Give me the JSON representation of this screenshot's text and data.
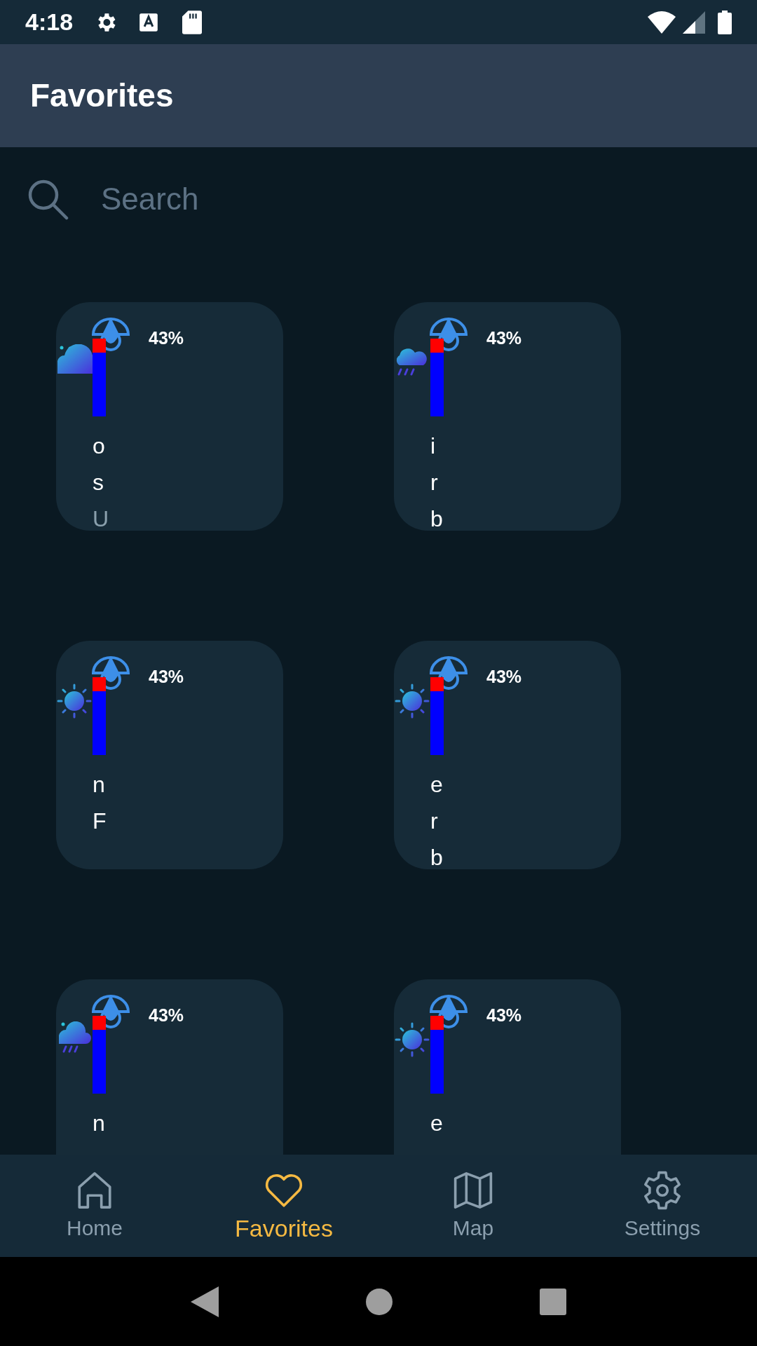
{
  "status_bar": {
    "time": "4:18"
  },
  "app_bar": {
    "title": "Favorites"
  },
  "search": {
    "placeholder": "Search"
  },
  "cards": [
    {
      "kind": "partly_cloudy",
      "humidity": "43%",
      "lines": [
        {
          "text": "o",
          "muted": false
        },
        {
          "text": "s",
          "muted": false
        },
        {
          "text": "U",
          "muted": true
        }
      ]
    },
    {
      "kind": "rain",
      "humidity": "43%",
      "lines": [
        {
          "text": "i",
          "muted": false
        },
        {
          "text": "r",
          "muted": false
        },
        {
          "text": "b",
          "muted": false
        }
      ]
    },
    {
      "kind": "sun",
      "humidity": "43%",
      "lines": [
        {
          "text": "n",
          "muted": false
        },
        {
          "text": "F",
          "muted": false
        }
      ]
    },
    {
      "kind": "sun",
      "humidity": "43%",
      "lines": [
        {
          "text": "e",
          "muted": false
        },
        {
          "text": "r",
          "muted": false
        },
        {
          "text": "b",
          "muted": false
        }
      ]
    },
    {
      "kind": "partly_rain",
      "humidity": "43%",
      "lines": [
        {
          "text": "n",
          "muted": false
        }
      ]
    },
    {
      "kind": "sun",
      "humidity": "43%",
      "lines": [
        {
          "text": "e",
          "muted": false
        }
      ]
    }
  ],
  "nav": [
    {
      "kind": "home",
      "label": "Home",
      "selected": false
    },
    {
      "kind": "favorites",
      "label": "Favorites",
      "selected": true
    },
    {
      "kind": "map",
      "label": "Map",
      "selected": false
    },
    {
      "kind": "settings",
      "label": "Settings",
      "selected": false
    }
  ]
}
